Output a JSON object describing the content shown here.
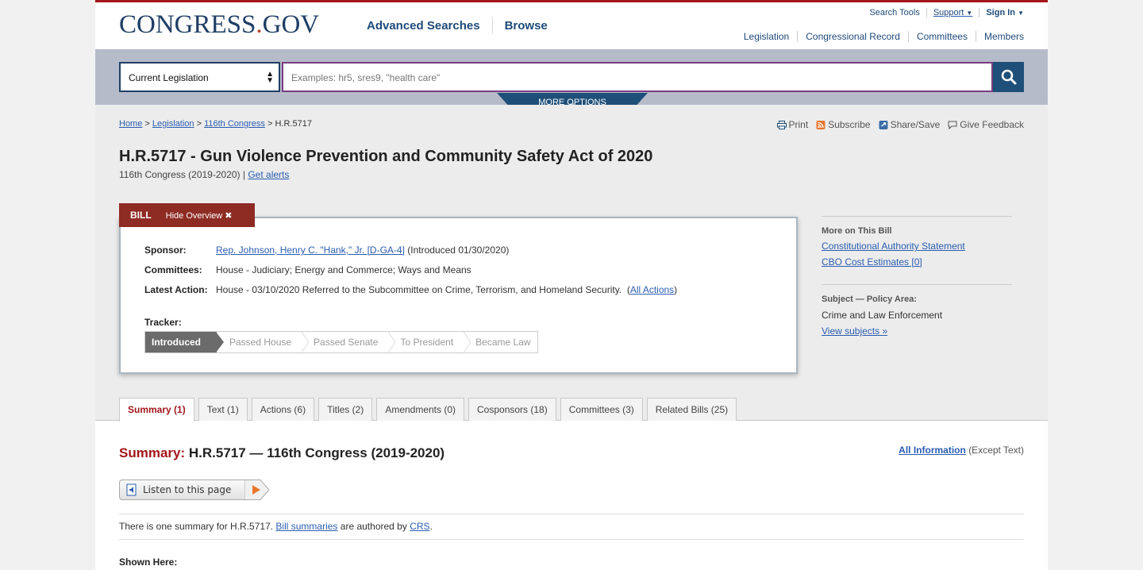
{
  "header": {
    "logo_main": "CONGRESS",
    "logo_dot": ".",
    "logo_tld": "GOV",
    "nav": [
      "Advanced Searches",
      "Browse"
    ],
    "util": {
      "search_tools": "Search Tools",
      "support": "Support",
      "signin": "Sign In"
    },
    "secondary_nav": [
      "Legislation",
      "Congressional Record",
      "Committees",
      "Members"
    ]
  },
  "search": {
    "scope": "Current Legislation",
    "placeholder": "Examples: hr5, sres9, \"health care\"",
    "more_options": "MORE OPTIONS"
  },
  "breadcrumb": {
    "home": "Home",
    "legislation": "Legislation",
    "congress": "116th Congress",
    "current": "H.R.5717",
    "sep": ">"
  },
  "tools": {
    "print": "Print",
    "subscribe": "Subscribe",
    "share": "Share/Save",
    "feedback": "Give Feedback"
  },
  "bill": {
    "title": "H.R.5717 - Gun Violence Prevention and Community Safety Act of 2020",
    "congress_text": "116th Congress (2019-2020) |",
    "get_alerts": "Get alerts",
    "tab_label": "BILL",
    "hide_overview": "Hide Overview ✖",
    "sponsor_label": "Sponsor:",
    "sponsor_link": "Rep. Johnson, Henry C. \"Hank,\" Jr. [D-GA-4]",
    "sponsor_intro": "(Introduced 01/30/2020)",
    "committees_label": "Committees:",
    "committees": "House - Judiciary; Energy and Commerce; Ways and Means",
    "latest_label": "Latest Action:",
    "latest": "House - 03/10/2020 Referred to the Subcommittee on Crime, Terrorism, and Homeland Security.",
    "all_actions_open": "(",
    "all_actions": "All Actions",
    "all_actions_close": ")",
    "tracker_label": "Tracker:",
    "tracker": [
      "Introduced",
      "Passed House",
      "Passed Senate",
      "To President",
      "Became Law"
    ],
    "tracker_current_index": 0
  },
  "sidebar": {
    "more_title": "More on This Bill",
    "more_links": [
      "Constitutional Authority Statement",
      "CBO Cost Estimates [0]"
    ],
    "subject_title": "Subject — Policy Area:",
    "subject_value": "Crime and Law Enforcement",
    "view_subjects": "View subjects »"
  },
  "tabs": [
    "Summary (1)",
    "Text (1)",
    "Actions (6)",
    "Titles (2)",
    "Amendments (0)",
    "Cosponsors (18)",
    "Committees (3)",
    "Related Bills (25)"
  ],
  "summary": {
    "title_red": "Summary:",
    "title_rest": "H.R.5717 — 116th Congress (2019-2020)",
    "all_info": "All Information",
    "except_text": "(Except Text)",
    "listen": "Listen to this page",
    "one_summary_pre": "There is one summary for H.R.5717.",
    "bill_summaries": "Bill summaries",
    "authored_by": "are authored by",
    "crs": "CRS",
    "period": ".",
    "shown_here": "Shown Here:"
  },
  "colors": {
    "brand_navy": "#1f3e66",
    "brand_red": "#a3161c",
    "link": "#2a5db0"
  }
}
